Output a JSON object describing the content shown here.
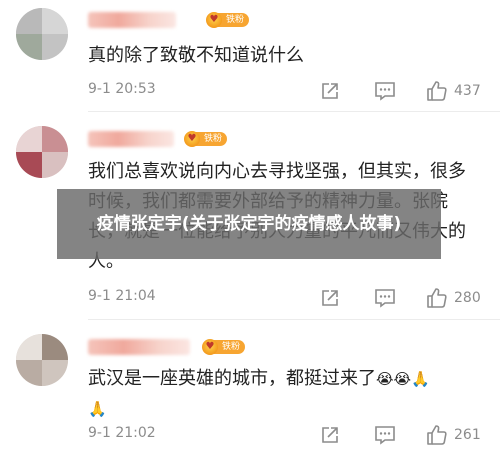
{
  "comments": [
    {
      "badge_label": "铁粉",
      "text": "真的除了致敬不知道说什么",
      "time": "9-1 20:53",
      "likes": "437"
    },
    {
      "badge_label": "铁粉",
      "text": "我们总喜欢说向内心去寻找坚强，但其实，很多时候，我们都需要外部给予的精神力量。张院长，就是一位能给予别人力量的平凡而又伟大的人。",
      "time": "9-1 21:04",
      "likes": "280"
    },
    {
      "badge_label": "铁粉",
      "text": "武汉是一座英雄的城市，都挺过来了",
      "emojis": [
        "😭",
        "😭",
        "🙏",
        "🙏"
      ],
      "time": "9-1 21:02",
      "likes": "261"
    }
  ],
  "overlay_title": "疫情张定宇(关于张定宇的疫情感人故事)",
  "icons": {
    "share": "share-icon",
    "comment": "comment-icon",
    "like": "thumbs-up-icon",
    "badge": "heart-badge-icon"
  },
  "colors": {
    "meta_gray": "#8c8c8c",
    "badge_orange": "#f7a531",
    "overlay": "#696969"
  }
}
